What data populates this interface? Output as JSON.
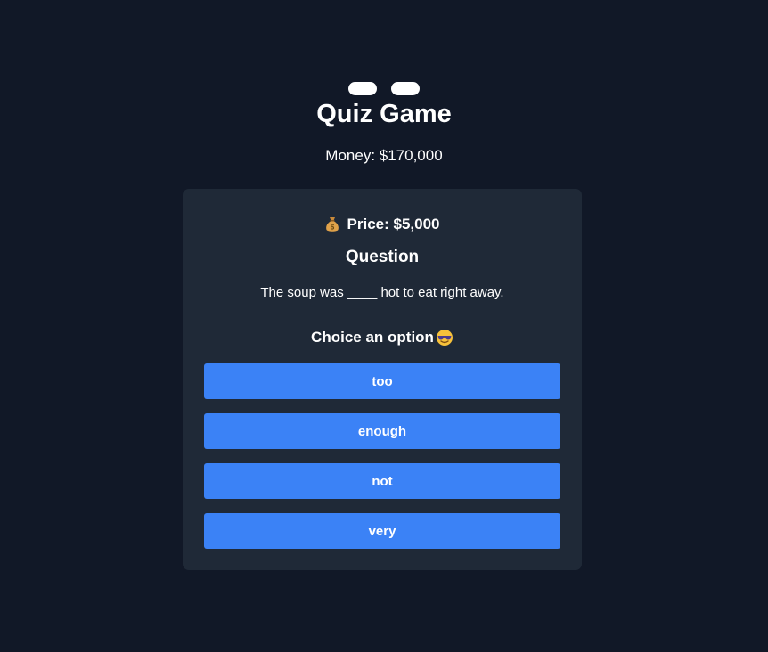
{
  "header": {
    "title": "Quiz Game",
    "money_label": "Money: $170,000"
  },
  "card": {
    "price_icon": "money-bag-icon",
    "price_label": "Price: $5,000",
    "question_heading": "Question",
    "question_text": "The soup was ____ hot to eat right away.",
    "choose_label": "Choice an option",
    "choose_icon": "cool-sunglasses-face-icon",
    "options": [
      "too",
      "enough",
      "not",
      "very"
    ]
  },
  "colors": {
    "background": "#111827",
    "card": "#1f2937",
    "button": "#3b82f6",
    "text": "#ffffff"
  }
}
